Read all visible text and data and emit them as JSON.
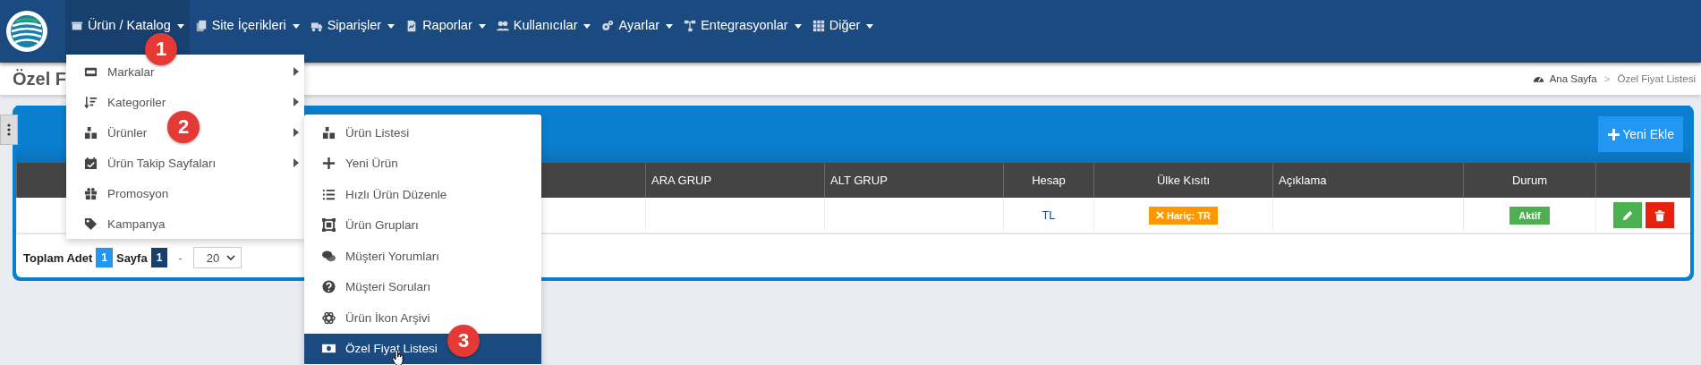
{
  "nav": {
    "items": [
      {
        "label": "Ürün / Katalog",
        "selected": true
      },
      {
        "label": "Site İçerikleri",
        "selected": false
      },
      {
        "label": "Siparişler",
        "selected": false
      },
      {
        "label": "Raporlar",
        "selected": false
      },
      {
        "label": "Kullanıcılar",
        "selected": false
      },
      {
        "label": "Ayarlar",
        "selected": false
      },
      {
        "label": "Entegrasyonlar",
        "selected": false
      },
      {
        "label": "Diğer",
        "selected": false
      }
    ]
  },
  "page_header": {
    "title": "Özel F",
    "breadcrumbs": [
      "Ana Sayfa",
      "Özel Fiyat Listesi"
    ],
    "breadcrumb_separator": ">"
  },
  "card": {
    "add_button": "Yeni Ekle",
    "columns": [
      "ARA GRUP",
      "ALT GRUP",
      "Hesap",
      "Ülke Kısıtı",
      "Açıklama",
      "Durum"
    ],
    "rows": [
      {
        "hesap": "TL",
        "restriction": "Hariç: TR",
        "status": "Aktif",
        "active": true
      }
    ],
    "footer": {
      "total_label": "Toplam Adet",
      "total": "1",
      "page_label": "Sayfa",
      "page": "1",
      "separator": "-",
      "page_size": "20"
    }
  },
  "menu": {
    "items": [
      {
        "label": "Markalar",
        "has_submenu": true
      },
      {
        "label": "Kategoriler",
        "has_submenu": true
      },
      {
        "label": "Ürünler",
        "has_submenu": true
      },
      {
        "label": "Ürün Takip Sayfaları",
        "has_submenu": true
      },
      {
        "label": "Promosyon",
        "has_submenu": false
      },
      {
        "label": "Kampanya",
        "has_submenu": false
      }
    ]
  },
  "submenu": {
    "items": [
      {
        "label": "Ürün Listesi",
        "selected": false
      },
      {
        "label": "Yeni Ürün",
        "selected": false
      },
      {
        "label": "Hızlı Ürün Düzenle",
        "selected": false
      },
      {
        "label": "Ürün Grupları",
        "selected": false
      },
      {
        "label": "Müşteri Yorumları",
        "selected": false
      },
      {
        "label": "Müşteri Soruları",
        "selected": false
      },
      {
        "label": "Ürün İkon Arşivi",
        "selected": false
      },
      {
        "label": "Özel Fiyat Listesi",
        "selected": true
      }
    ]
  },
  "callouts": [
    "1",
    "2",
    "3"
  ]
}
